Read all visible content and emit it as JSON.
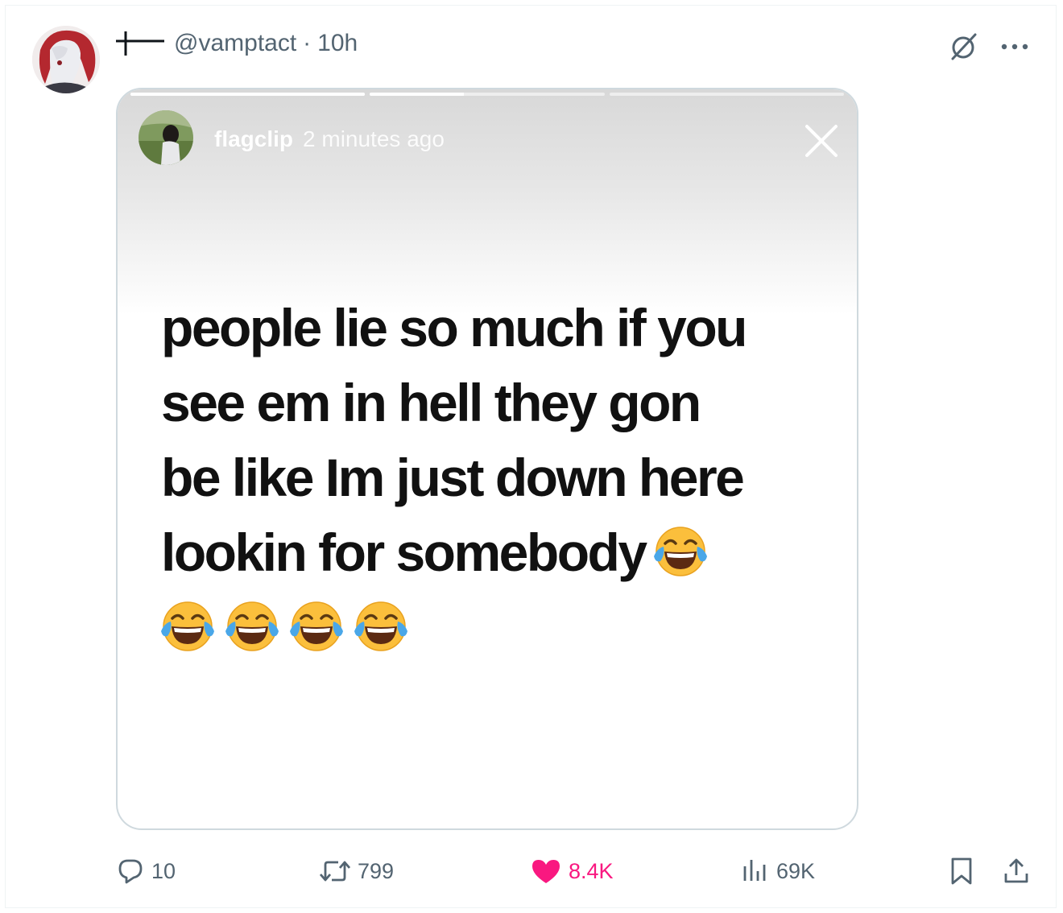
{
  "post": {
    "handle": "@vamptact",
    "separator": "·",
    "time": "10h"
  },
  "story": {
    "username": "flagclip",
    "time_ago": "2 minutes ago",
    "text_lines": [
      "people lie so much if you",
      "see em in hell they gon",
      "be like Im just down here",
      "lookin for somebody"
    ],
    "emoji_name": "face-with-tears-of-joy",
    "progress": [
      1.0,
      0.4,
      0.0
    ]
  },
  "actions": {
    "replies": "10",
    "reposts": "799",
    "likes": "8.4K",
    "views": "69K"
  },
  "colors": {
    "text_secondary": "#536471",
    "like_pink": "#f91880",
    "border": "#cfd9de"
  },
  "icons": [
    "grok-icon",
    "more-icon",
    "reply-icon",
    "repost-icon",
    "heart-icon",
    "views-icon",
    "bookmark-icon",
    "share-icon",
    "close-icon"
  ]
}
